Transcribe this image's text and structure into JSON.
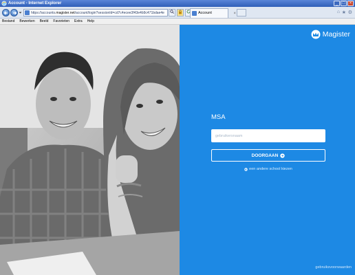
{
  "window": {
    "title": "Account - Internet Explorer",
    "controls": [
      "_",
      "□",
      "×"
    ]
  },
  "navbar": {
    "url_prefix": "https://accounts.",
    "url_domain": "magister.net",
    "url_rest": "/account/login?sessionId=cd7c4ecee3f43e4b9c471bdae4e",
    "tab_title": "Account"
  },
  "menu": [
    "Bestand",
    "Bewerken",
    "Beeld",
    "Favorieten",
    "Extra",
    "Help"
  ],
  "login": {
    "brand": "Magister",
    "school": "MSA",
    "username_placeholder": "gebruikersnaam",
    "continue_label": "DOORGAAN",
    "choose_school": "een andere school kiezen",
    "terms": "gebruiksvoorwaarden"
  },
  "colors": {
    "panel": "#1d89e4",
    "titlebar": "#2f5fb8"
  }
}
